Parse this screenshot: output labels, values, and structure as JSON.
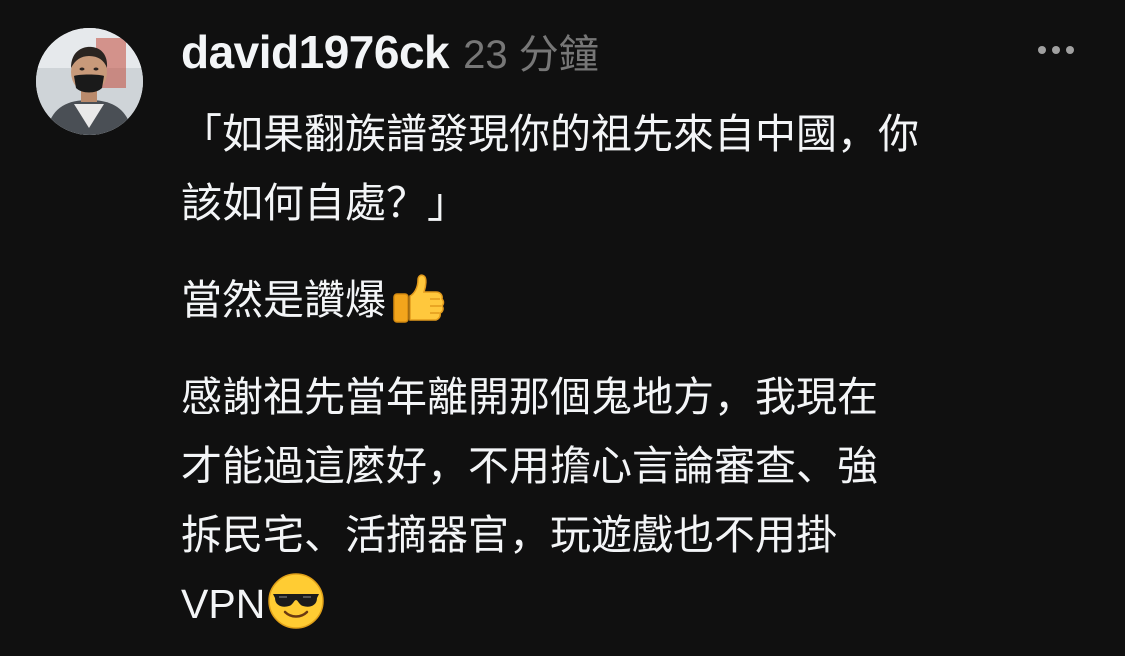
{
  "post": {
    "username": "david1976ck",
    "timestamp": "23 分鐘",
    "paragraphs": [
      {
        "lines": [
          "「如果翻族譜發現你的祖先來自中國，你",
          "該如何自處？」"
        ]
      },
      {
        "lines": [
          "當然是讚爆"
        ],
        "emoji": "thumbs-up"
      },
      {
        "lines": [
          "感謝祖先當年離開那個鬼地方，我現在",
          "才能過這麼好，不用擔心言論審查、強",
          "拆民宅、活摘器官，玩遊戲也不用掛",
          "VPN"
        ],
        "emoji": "sunglasses-face"
      }
    ]
  },
  "icons": {
    "avatar": "user-avatar",
    "more": "more-options-icon",
    "emoji_1": "thumbs-up-emoji",
    "emoji_2": "smiling-face-with-sunglasses-emoji"
  },
  "colors": {
    "background": "#101010",
    "text_primary": "#f3f5f7",
    "text_secondary": "#777777",
    "icon_gray": "#a0a0a0"
  }
}
